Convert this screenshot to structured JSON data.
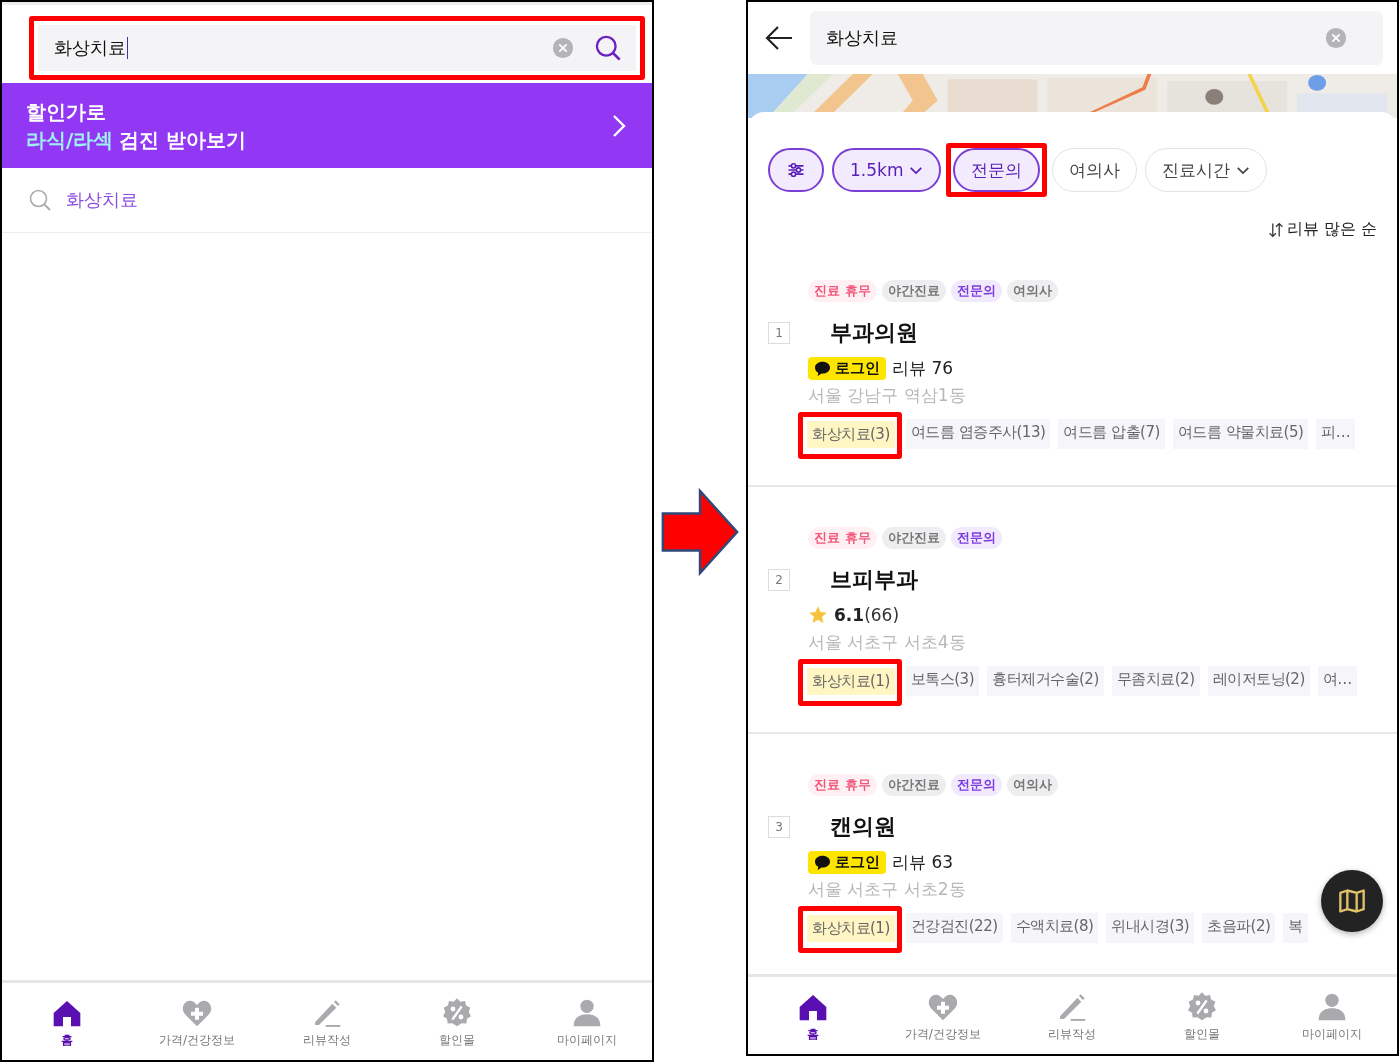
{
  "left_screen": {
    "search": {
      "value": "화상치료",
      "highlighted": true
    },
    "banner": {
      "line_1": "할인가로",
      "line_2_accent": "라식/라섹",
      "line_2_rest": "검진 받아보기"
    },
    "suggestions": [
      {
        "text": "화상치료"
      }
    ],
    "nav": [
      {
        "kind": "home",
        "label": "홈",
        "selected": true
      },
      {
        "kind": "heart",
        "label": "가격/건강정보",
        "selected": false
      },
      {
        "kind": "pencil",
        "label": "리뷰작성",
        "selected": false
      },
      {
        "kind": "percent",
        "label": "할인몰",
        "selected": false
      },
      {
        "kind": "person",
        "label": "마이페이지",
        "selected": false
      }
    ]
  },
  "right_screen": {
    "search": {
      "value": "화상치료"
    },
    "filters": [
      {
        "kind": "icon",
        "selected": true,
        "highlighted": false
      },
      {
        "kind": "dropdown",
        "label": "1.5km",
        "selected": true,
        "highlighted": false
      },
      {
        "kind": "toggle",
        "label": "전문의",
        "selected": true,
        "highlighted": true
      },
      {
        "kind": "toggle",
        "label": "여의사",
        "selected": false,
        "highlighted": false
      },
      {
        "kind": "dropdown",
        "label": "진료시간",
        "selected": false,
        "highlighted": false
      }
    ],
    "sort": "리뷰 많은 순",
    "clinics": [
      {
        "rank": "1",
        "badges": [
          {
            "kind": "closed",
            "label": "진료 휴무"
          },
          {
            "kind": "plain",
            "label": "야간진료"
          },
          {
            "kind": "specialist",
            "label": "전문의"
          },
          {
            "kind": "plain",
            "label": "여의사"
          }
        ],
        "name": "부과의원",
        "info": {
          "kind": "login",
          "badge": "로그인",
          "text": "리뷰 76"
        },
        "address": "서울 강남구 역삼1동",
        "treatments": [
          {
            "label": "화상치료(3)",
            "matched": true,
            "highlighted": true
          },
          {
            "label": "여드름 염증주사(13)",
            "matched": false,
            "highlighted": false
          },
          {
            "label": "여드름 압출(7)",
            "matched": false,
            "highlighted": false
          },
          {
            "label": "여드름 약물치료(5)",
            "matched": false,
            "highlighted": false
          },
          {
            "label": "피…",
            "matched": false,
            "highlighted": false
          }
        ]
      },
      {
        "rank": "2",
        "badges": [
          {
            "kind": "closed",
            "label": "진료 휴무"
          },
          {
            "kind": "plain",
            "label": "야간진료"
          },
          {
            "kind": "specialist",
            "label": "전문의"
          }
        ],
        "name": "브피부과",
        "info": {
          "kind": "rating",
          "score": "6.1",
          "count": "(66)"
        },
        "address": "서울 서초구 서초4동",
        "treatments": [
          {
            "label": "화상치료(1)",
            "matched": true,
            "highlighted": true
          },
          {
            "label": "보톡스(3)",
            "matched": false,
            "highlighted": false
          },
          {
            "label": "흉터제거수술(2)",
            "matched": false,
            "highlighted": false
          },
          {
            "label": "무좀치료(2)",
            "matched": false,
            "highlighted": false
          },
          {
            "label": "레이저토닝(2)",
            "matched": false,
            "highlighted": false
          },
          {
            "label": "여…",
            "matched": false,
            "highlighted": false
          }
        ]
      },
      {
        "rank": "3",
        "badges": [
          {
            "kind": "closed",
            "label": "진료 휴무"
          },
          {
            "kind": "plain",
            "label": "야간진료"
          },
          {
            "kind": "specialist",
            "label": "전문의"
          },
          {
            "kind": "plain",
            "label": "여의사"
          }
        ],
        "name": "캔의원",
        "info": {
          "kind": "login",
          "badge": "로그인",
          "text": "리뷰 63"
        },
        "address": "서울 서초구 서초2동",
        "treatments": [
          {
            "label": "화상치료(1)",
            "matched": true,
            "highlighted": true
          },
          {
            "label": "건강검진(22)",
            "matched": false,
            "highlighted": false
          },
          {
            "label": "수액치료(8)",
            "matched": false,
            "highlighted": false
          },
          {
            "label": "위내시경(3)",
            "matched": false,
            "highlighted": false
          },
          {
            "label": "초음파(2)",
            "matched": false,
            "highlighted": false
          },
          {
            "label": "복",
            "matched": false,
            "highlighted": false
          }
        ]
      }
    ],
    "nav": [
      {
        "kind": "home",
        "label": "홈",
        "selected": true
      },
      {
        "kind": "heart",
        "label": "가격/건강정보",
        "selected": false
      },
      {
        "kind": "pencil",
        "label": "리뷰작성",
        "selected": false
      },
      {
        "kind": "percent",
        "label": "할인몰",
        "selected": false
      },
      {
        "kind": "person",
        "label": "마이페이지",
        "selected": false
      }
    ]
  }
}
